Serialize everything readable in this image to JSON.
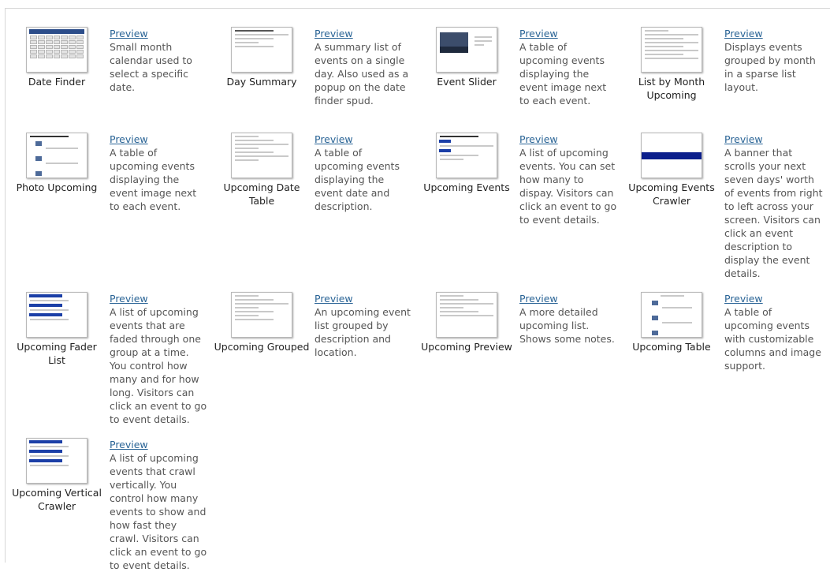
{
  "preview_label": "Preview",
  "items": [
    {
      "name": "Date Finder",
      "icon": "mini-calendar-thumbnail",
      "desc": "Small month calendar used to select a specific date."
    },
    {
      "name": "Day Summary",
      "icon": "day-summary-thumbnail",
      "desc": "A summary list of events on a single day. Also used as a popup on the date finder spud."
    },
    {
      "name": "Event Slider",
      "icon": "event-slider-thumbnail",
      "desc": "A table of upcoming events displaying the event image next to each event."
    },
    {
      "name": "List by Month Upcoming",
      "icon": "month-list-thumbnail",
      "desc": "Displays events grouped by month in a sparse list layout."
    },
    {
      "name": "Photo Upcoming",
      "icon": "photo-list-thumbnail",
      "desc": "A table of upcoming events displaying the event image next to each event."
    },
    {
      "name": "Upcoming Date Table",
      "icon": "date-table-thumbnail",
      "desc": "A table of upcoming events displaying the event date and description."
    },
    {
      "name": "Upcoming Events",
      "icon": "upcoming-events-thumbnail",
      "desc": "A list of upcoming events. You can set how many to dispay. Visitors can click an event to go to event details."
    },
    {
      "name": "Upcoming Events Crawler",
      "icon": "banner-crawler-thumbnail",
      "desc": "A banner that scrolls your next seven days' worth of events from right to left across your screen. Visitors can click an event description to display the event details."
    },
    {
      "name": "Upcoming Fader List",
      "icon": "fader-list-thumbnail",
      "desc": "A list of upcoming events that are faded through one group at a time. You control how many and for how long. Visitors can click an event to go to event details."
    },
    {
      "name": "Upcoming Grouped",
      "icon": "grouped-list-thumbnail",
      "desc": "An upcoming event list grouped by description and location."
    },
    {
      "name": "Upcoming Preview",
      "icon": "preview-list-thumbnail",
      "desc": "A more detailed upcoming list. Shows some notes."
    },
    {
      "name": "Upcoming Table",
      "icon": "image-table-thumbnail",
      "desc": "A table of upcoming events with customizable columns and image support."
    },
    {
      "name": "Upcoming Vertical Crawler",
      "icon": "vertical-crawler-thumbnail",
      "desc": "A list of upcoming events that crawl vertically. You control how many events to show and how fast they crawl. Visitors can click an event to go to event details."
    }
  ]
}
